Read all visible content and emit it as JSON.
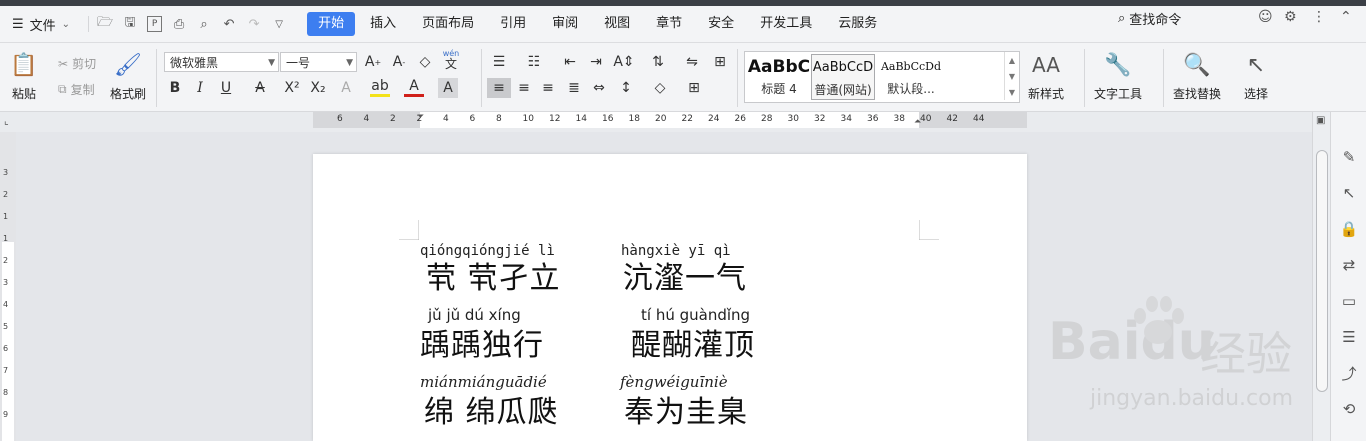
{
  "menubar": {
    "file_label": "文件",
    "tabs": [
      "开始",
      "插入",
      "页面布局",
      "引用",
      "审阅",
      "视图",
      "章节",
      "安全",
      "开发工具",
      "云服务"
    ],
    "active_tab": "开始",
    "search_command": "查找命令"
  },
  "ribbon": {
    "paste": "粘贴",
    "cut": "剪切",
    "copy": "复制",
    "format_painter": "格式刷",
    "font_name": "微软雅黑",
    "font_size": "一号",
    "pinyin_btn_top": "wén",
    "pinyin_btn_bottom": "文",
    "styles": [
      {
        "sample": "AaBbC",
        "name": "标题 4"
      },
      {
        "sample": "AaBbCcD",
        "name": "普通(网站)"
      },
      {
        "sample": "AaBbCcDd",
        "name": "默认段..."
      }
    ],
    "new_style": "新样式",
    "text_tools": "文字工具",
    "find_replace": "查找替换",
    "select": "选择"
  },
  "ruler": {
    "ticks": [
      "6",
      "4",
      "2",
      "2",
      "4",
      "6",
      "8",
      "10",
      "12",
      "14",
      "16",
      "18",
      "20",
      "22",
      "24",
      "26",
      "28",
      "30",
      "32",
      "34",
      "36",
      "38",
      "40",
      "42",
      "44"
    ],
    "vticks": [
      "3",
      "2",
      "1",
      "1",
      "2",
      "3",
      "4",
      "5",
      "6",
      "7",
      "8",
      "9"
    ]
  },
  "document": {
    "entries": [
      {
        "pinyin": "qióngqióngjié lì",
        "hanzi": "茕 茕孑立"
      },
      {
        "pinyin": "hàngxiè yī  qì",
        "hanzi": "沆瀣一气"
      },
      {
        "pinyin": "jǔ  jǔ  dú xíng",
        "hanzi": "踽踽独行"
      },
      {
        "pinyin": "tí  hú guàndǐng",
        "hanzi": "醍醐灌顶"
      },
      {
        "pinyin": "miánmiánguādié",
        "hanzi": "绵 绵瓜瓞"
      },
      {
        "pinyin": "fèngwéiguīniè",
        "hanzi": "奉为圭臬"
      }
    ]
  },
  "watermark": {
    "brand": "Baidu",
    "brand_cn": "经验",
    "url": "jingyan.baidu.com"
  },
  "colors": {
    "accent": "#3d7ef0",
    "menubar_bg": "#f3f4f6",
    "canvas_bg": "#e4e6ea"
  }
}
